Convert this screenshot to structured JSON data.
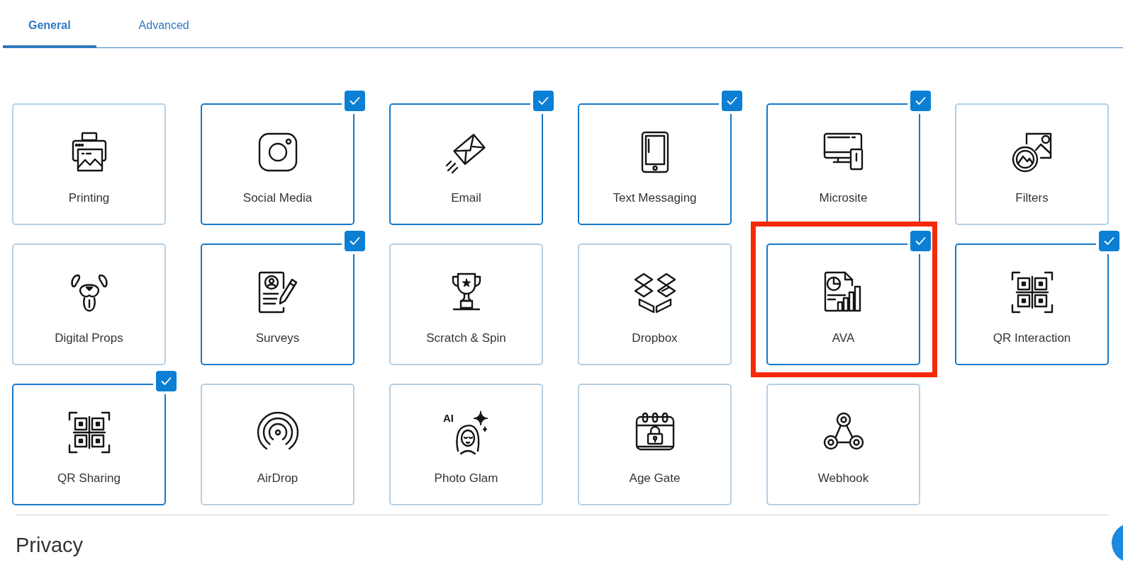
{
  "tabs": [
    {
      "label": "General",
      "selected": true
    },
    {
      "label": "Advanced",
      "selected": false
    }
  ],
  "tiles": [
    {
      "label": "Printing",
      "selected": false,
      "highlighted": false
    },
    {
      "label": "Social Media",
      "selected": true,
      "highlighted": false
    },
    {
      "label": "Email",
      "selected": true,
      "highlighted": false
    },
    {
      "label": "Text Messaging",
      "selected": true,
      "highlighted": false
    },
    {
      "label": "Microsite",
      "selected": true,
      "highlighted": false
    },
    {
      "label": "Filters",
      "selected": false,
      "highlighted": false
    },
    {
      "label": "Digital Props",
      "selected": false,
      "highlighted": false
    },
    {
      "label": "Surveys",
      "selected": true,
      "highlighted": false
    },
    {
      "label": "Scratch & Spin",
      "selected": false,
      "highlighted": false
    },
    {
      "label": "Dropbox",
      "selected": false,
      "highlighted": false
    },
    {
      "label": "AVA",
      "selected": true,
      "highlighted": true
    },
    {
      "label": "QR Interaction",
      "selected": true,
      "highlighted": false
    },
    {
      "label": "QR Sharing",
      "selected": true,
      "highlighted": false
    },
    {
      "label": "AirDrop",
      "selected": false,
      "highlighted": false
    },
    {
      "label": "Photo Glam",
      "selected": false,
      "highlighted": false,
      "icon_text": "AI"
    },
    {
      "label": "Age Gate",
      "selected": false,
      "highlighted": false
    },
    {
      "label": "Webhook",
      "selected": false,
      "highlighted": false
    }
  ],
  "section": {
    "title": "Privacy"
  }
}
